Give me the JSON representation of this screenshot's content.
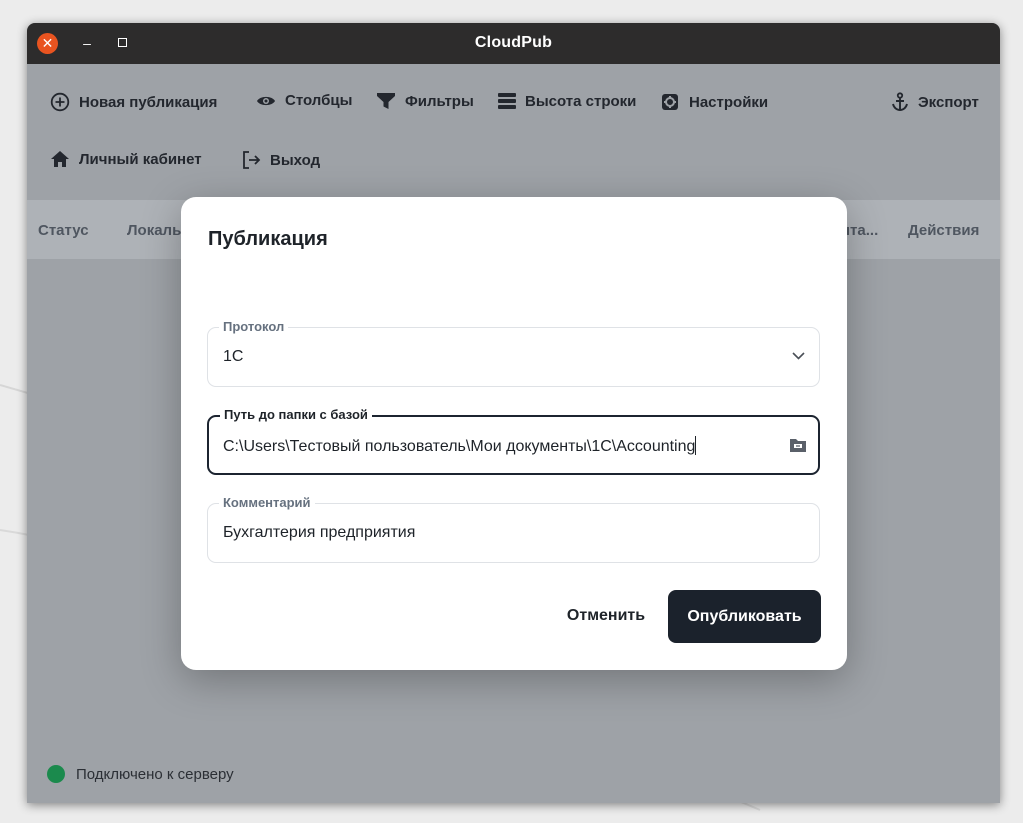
{
  "window": {
    "title": "CloudPub"
  },
  "toolbar": {
    "new_publication": "Новая публикация",
    "columns": "Столбцы",
    "filters": "Фильтры",
    "row_height": "Высота строки",
    "settings": "Настройки",
    "export": "Экспорт",
    "account": "Личный кабинет",
    "logout": "Выход"
  },
  "table": {
    "headers": [
      "Статус",
      "Локаль",
      "нта...",
      "Действия"
    ]
  },
  "status_bar": {
    "text": "Подключено к серверу",
    "color": "#1b8a4d"
  },
  "dialog": {
    "title": "Публикация",
    "protocol": {
      "label": "Протокол",
      "value": "1С"
    },
    "path": {
      "label": "Путь до папки с базой",
      "value": "C:\\Users\\Тестовый пользователь\\Мои документы\\1C\\Accounting"
    },
    "comment": {
      "label": "Комментарий",
      "value": "Бухгалтерия предприятия"
    },
    "cancel_label": "Отменить",
    "publish_label": "Опубликовать"
  },
  "colors": {
    "accent_dark": "#1b222c",
    "close_button": "#e95420",
    "titlebar": "#2d2c2c"
  }
}
